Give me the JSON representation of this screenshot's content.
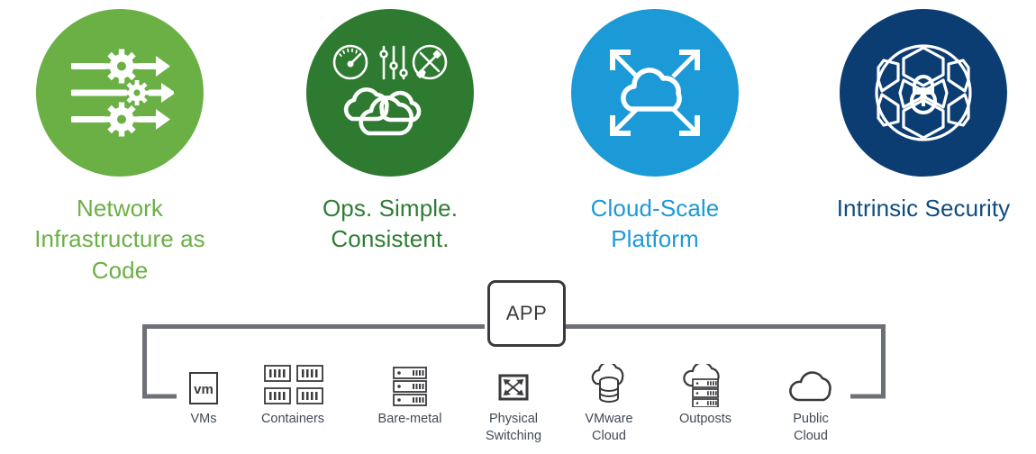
{
  "pillars": [
    {
      "id": "network-infrastructure-as-code",
      "label": "Network\nInfrastructure as\nCode",
      "color": "#6BB045",
      "circle_color": "#6BB044",
      "icon": "gears-pipeline-arrows-icon"
    },
    {
      "id": "ops-simple-consistent",
      "label": "Ops. Simple.\nConsistent.",
      "color": "#2E7D33",
      "circle_color": "#2D7A30",
      "icon": "gauge-sliders-tools-clouds-icon"
    },
    {
      "id": "cloud-scale-platform",
      "label": "Cloud-Scale\nPlatform",
      "color": "#1B9AD7",
      "circle_color": "#1B9AD7",
      "icon": "cloud-expand-arrows-icon"
    },
    {
      "id": "intrinsic-security",
      "label": "Intrinsic Security",
      "color": "#0E4C82",
      "circle_color": "#0B3D73",
      "icon": "honeycomb-sphere-lock-icon"
    }
  ],
  "app": {
    "label": "APP",
    "border_color": "#3B3B3E"
  },
  "bracket": {
    "color": "#6E7077",
    "stroke_width": 5
  },
  "infrastructure": [
    {
      "id": "vms",
      "label": "VMs",
      "icon": "vm-box-icon",
      "icon_text": "vm"
    },
    {
      "id": "containers",
      "label": "Containers",
      "icon": "containers-grid-icon",
      "icon_text": ""
    },
    {
      "id": "bare-metal",
      "label": "Bare-metal",
      "icon": "server-stack-icon",
      "icon_text": ""
    },
    {
      "id": "physical-switching",
      "label": "Physical\nSwitching",
      "icon": "switch-crossbar-icon",
      "icon_text": ""
    },
    {
      "id": "vmware-cloud",
      "label": "VMware\nCloud",
      "icon": "cloud-database-icon",
      "icon_text": ""
    },
    {
      "id": "outposts",
      "label": "Outposts",
      "icon": "cloud-servers-icon",
      "icon_text": ""
    },
    {
      "id": "public-cloud",
      "label": "Public\nCloud",
      "icon": "cloud-outline-icon",
      "icon_text": ""
    }
  ],
  "colors": {
    "label_gray": "#3F4A56",
    "icon_stroke": "#3B3B3E",
    "background": "#ffffff"
  }
}
